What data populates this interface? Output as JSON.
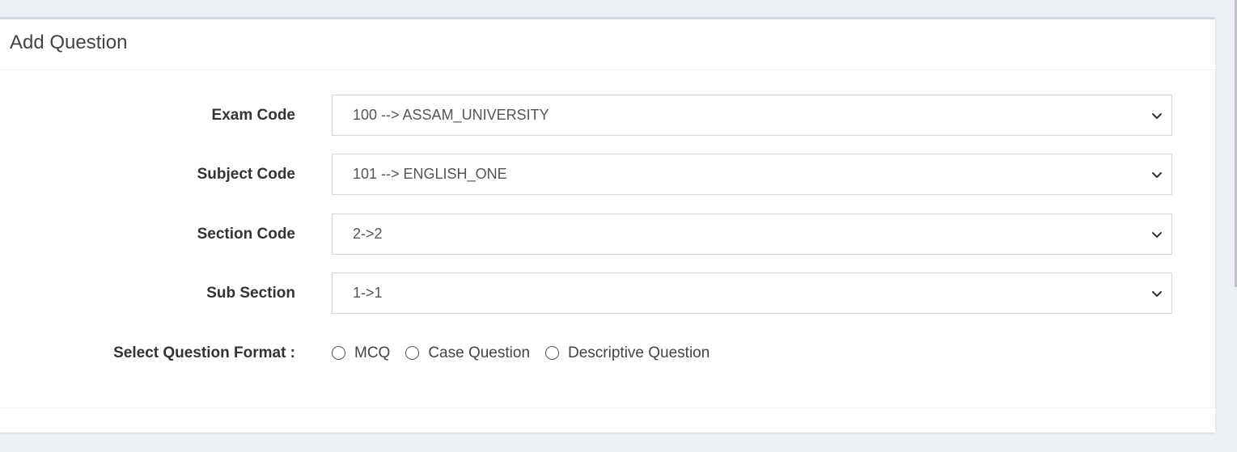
{
  "card": {
    "title": "Add Question"
  },
  "form": {
    "exam_code": {
      "label": "Exam Code",
      "selected": "100 --> ASSAM_UNIVERSITY"
    },
    "subject_code": {
      "label": "Subject Code",
      "selected": "101 --> ENGLISH_ONE"
    },
    "section_code": {
      "label": "Section Code",
      "selected": "2->2"
    },
    "sub_section": {
      "label": "Sub Section",
      "selected": "1->1"
    },
    "question_format": {
      "label": "Select Question Format :",
      "options": [
        "MCQ",
        "Case Question",
        "Descriptive Question"
      ]
    }
  },
  "icons": {
    "dropdown": "chevron-down-icon",
    "radio": "radio-unchecked-icon"
  },
  "colors": {
    "page_background": "#eceff4",
    "card_background": "#ffffff",
    "border": "#d2d6de",
    "label_text": "#333333"
  }
}
